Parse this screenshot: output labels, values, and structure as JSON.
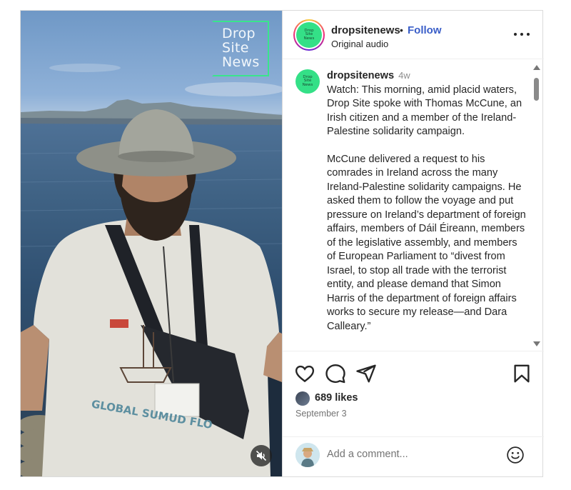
{
  "media": {
    "watermark": [
      "Drop",
      "Site",
      "News"
    ],
    "shirt_text": "GLOBAL SUMUD FLO",
    "mute_icon": "speaker-muted-icon"
  },
  "header": {
    "avatar_logo": [
      "Drop",
      "Site",
      "News"
    ],
    "username": "dropsitenews",
    "separator": "•",
    "follow_label": "Follow",
    "audio": "Original audio",
    "more_icon": "more-horizontal-icon"
  },
  "caption": {
    "username": "dropsitenews",
    "time": "4w",
    "paragraphs": [
      "Watch: This morning, amid placid waters, Drop Site spoke with Thomas McCune, an Irish citizen and a member of the Ireland-Palestine solidarity campaign.",
      "McCune delivered a request to his comrades in Ireland across the many Ireland-Palestine solidarity campaigns. He asked them to follow the voyage and put pressure on Ireland’s department of foreign affairs, members of Dáil Éireann, members of the legislative assembly, and members of European Parliament to “divest from Israel, to stop all trade with the terrorist entity, and please demand that Simon Harris of the department of foreign affairs works to secure my release—and Dara Calleary.”"
    ]
  },
  "actions": {
    "icons": [
      "heart-icon",
      "comment-icon",
      "share-icon",
      "bookmark-icon"
    ],
    "likes": "689 likes",
    "date": "September 3"
  },
  "comment": {
    "placeholder": "Add a comment...",
    "emoji_icon": "emoji-icon"
  },
  "colors": {
    "accent_follow": "#3a5ec8",
    "logo_green": "#34e087",
    "watermark_green": "#39e58c"
  }
}
